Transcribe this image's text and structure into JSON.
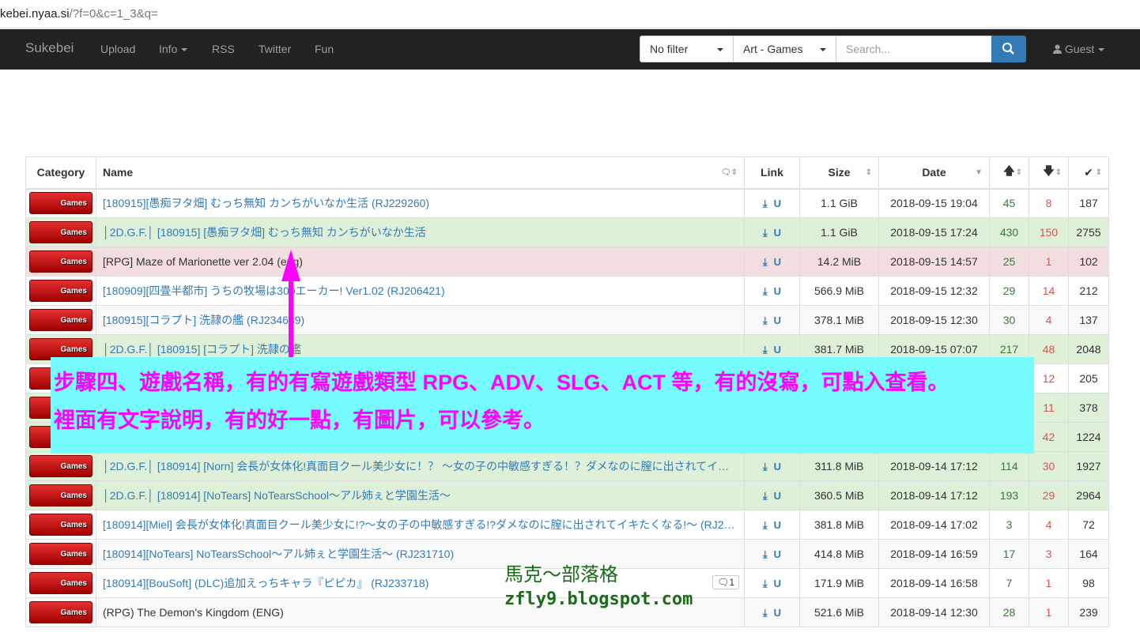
{
  "browser": {
    "url_host": "kebei.nyaa.si",
    "url_path": "/?f=0&c=1_3&q="
  },
  "navbar": {
    "brand": "Sukebei",
    "links": [
      "Upload",
      "Info",
      "RSS",
      "Twitter",
      "Fun"
    ],
    "filter_value": "No filter",
    "category_value": "Art - Games",
    "search_placeholder": "Search...",
    "user_label": "Guest"
  },
  "table": {
    "headers": {
      "category": "Category",
      "name": "Name",
      "link": "Link",
      "size": "Size",
      "date": "Date"
    },
    "category_badge": "Games",
    "rows": [
      {
        "name": "[180915][愚痴ヲタ畑] むっち無知 カンちがいなか生活 (RJ229260)",
        "size": "1.1 GiB",
        "date": "2018-09-15 19:04",
        "seeders": "45",
        "leechers": "8",
        "completed": "187",
        "style": "default"
      },
      {
        "name": "│2D.G.F.│ [180915] [愚痴ヲタ畑] むっち無知 カンちがいなか生活",
        "size": "1.1 GiB",
        "date": "2018-09-15 17:24",
        "seeders": "430",
        "leechers": "150",
        "completed": "2755",
        "style": "success"
      },
      {
        "name": "[RPG] Maze of Marionette ver 2.04 (eng)",
        "size": "14.2 MiB",
        "date": "2018-09-15 14:57",
        "seeders": "25",
        "leechers": "1",
        "completed": "102",
        "style": "danger"
      },
      {
        "name": "[180909][四畳半都市] うちの牧場は300エーカー! Ver1.02 (RJ206421)",
        "size": "566.9 MiB",
        "date": "2018-09-15 12:32",
        "seeders": "29",
        "leechers": "14",
        "completed": "212",
        "style": "default"
      },
      {
        "name": "[180915][コラプト] 洗隷の艦 (RJ234639)",
        "size": "378.1 MiB",
        "date": "2018-09-15 12:30",
        "seeders": "30",
        "leechers": "4",
        "completed": "137",
        "style": "alt"
      },
      {
        "name": "│2D.G.F.│ [180915] [コラプト] 洗隷の艦",
        "size": "381.7 MiB",
        "date": "2018-09-15 07:07",
        "seeders": "217",
        "leechers": "48",
        "completed": "2048",
        "style": "success"
      },
      {
        "name": "",
        "size": "",
        "date": "",
        "seeders": "",
        "leechers": "12",
        "completed": "205",
        "style": "default"
      },
      {
        "name": "",
        "size": "",
        "date": "",
        "seeders": "",
        "leechers": "11",
        "completed": "378",
        "style": "success"
      },
      {
        "name": "",
        "size": "",
        "date": "",
        "seeders": "",
        "leechers": "42",
        "completed": "1224",
        "style": "success"
      },
      {
        "name": "│2D.G.F.│ [180914] [Norn] 会長が女体化!真面目クール美少女に！？ ～女の子の中敏感すぎる！？ダメなのに膣に出されてイ…",
        "size": "311.8 MiB",
        "date": "2018-09-14 17:12",
        "seeders": "114",
        "leechers": "30",
        "completed": "1927",
        "style": "success"
      },
      {
        "name": "│2D.G.F.│ [180914] [NoTears] NoTearsSchool～アル姉ぇと学園生活～",
        "size": "360.5 MiB",
        "date": "2018-09-14 17:12",
        "seeders": "193",
        "leechers": "29",
        "completed": "2964",
        "style": "success"
      },
      {
        "name": "[180914][Miel] 会長が女体化!真面目クール美少女に!?～女の子の中敏感すぎる!?ダメなのに膣に出されてイキたくなる!～ (RJ2…",
        "size": "381.8 MiB",
        "date": "2018-09-14 17:02",
        "seeders": "3",
        "leechers": "4",
        "completed": "72",
        "style": "default"
      },
      {
        "name": "[180914][NoTears] NoTearsSchool～アル姉ぇと学園生活～ (RJ231710)",
        "size": "414.8 MiB",
        "date": "2018-09-14 16:59",
        "seeders": "17",
        "leechers": "3",
        "completed": "164",
        "style": "alt"
      },
      {
        "name": "[180914][BouSoft] (DLC)追加えっちキャラ『ピピカ』 (RJ233718)",
        "size": "171.9 MiB",
        "date": "2018-09-14 16:58",
        "seeders": "7",
        "leechers": "1",
        "completed": "98",
        "style": "default",
        "comments": "1"
      },
      {
        "name": "(RPG) The Demon's Kingdom (ENG)",
        "size": "521.6 MiB",
        "date": "2018-09-14 12:30",
        "seeders": "28",
        "leechers": "1",
        "completed": "239",
        "style": "alt"
      }
    ]
  },
  "overlay": {
    "line1": "步驟四、遊戲名稱，有的有寫遊戲類型 RPG、ADV、SLG、ACT 等，有的沒寫，可點入查看。",
    "line2": "裡面有文字說明，有的好一點，有圖片，可以參考。"
  },
  "watermark": {
    "line1": "馬克～部落格",
    "line2": "zfly9.blogspot.com"
  },
  "colors": {
    "navbar": "#222222",
    "accent": "#337ab7",
    "overlay_bg": "#76fbff",
    "overlay_text": "#ff00ff",
    "seed": "#3c763d",
    "leech": "#d9534f"
  }
}
